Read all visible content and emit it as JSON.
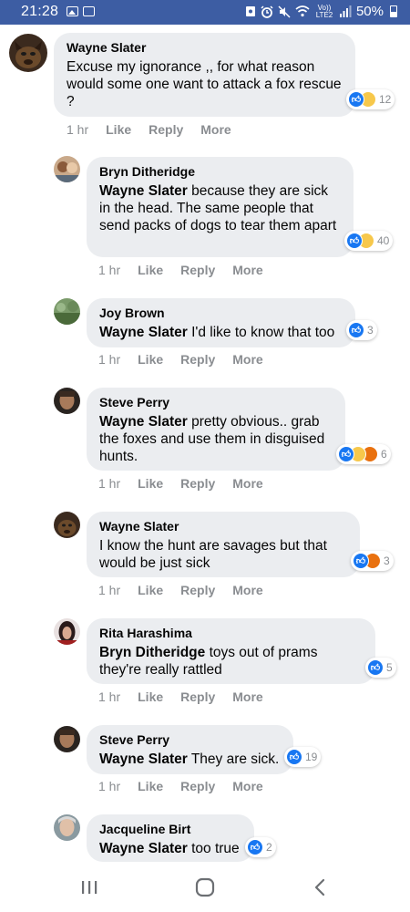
{
  "status_bar": {
    "time": "21:28",
    "network_label": "Vo)) LTE2",
    "battery": "50%"
  },
  "comments": [
    {
      "author": "Wayne Slater",
      "tag": "",
      "text": "Excuse my ignorance ,, for what reason would some one want to attack a fox rescue ?",
      "time": "1 hr",
      "like_label": "Like",
      "reply_label": "Reply",
      "more_label": "More",
      "reaction_count": "12",
      "reactions": [
        "like",
        "sad"
      ]
    },
    {
      "author": "Bryn Ditheridge",
      "tag": "Wayne Slater",
      "text": "because they are sick in the head. The same people that send packs of dogs to tear them apart",
      "time": "1 hr",
      "like_label": "Like",
      "reply_label": "Reply",
      "more_label": "More",
      "reaction_count": "40",
      "reactions": [
        "like",
        "sad"
      ]
    },
    {
      "author": "Joy Brown",
      "tag": "Wayne Slater",
      "text": "I'd like to know that too",
      "time": "1 hr",
      "like_label": "Like",
      "reply_label": "Reply",
      "more_label": "More",
      "reaction_count": "3",
      "reactions": [
        "like"
      ]
    },
    {
      "author": "Steve Perry",
      "tag": "Wayne Slater",
      "text": "pretty obvious.. grab the foxes and use them in disguised hunts.",
      "time": "1 hr",
      "like_label": "Like",
      "reply_label": "Reply",
      "more_label": "More",
      "reaction_count": "6",
      "reactions": [
        "like",
        "sad",
        "angry"
      ]
    },
    {
      "author": "Wayne Slater",
      "tag": "",
      "text": "I know the hunt are savages but that would be just sick",
      "time": "1 hr",
      "like_label": "Like",
      "reply_label": "Reply",
      "more_label": "More",
      "reaction_count": "3",
      "reactions": [
        "like",
        "angry"
      ]
    },
    {
      "author": "Rita Harashima",
      "tag": "Bryn Ditheridge",
      "text": "toys out of prams they're really rattled",
      "time": "1 hr",
      "like_label": "Like",
      "reply_label": "Reply",
      "more_label": "More",
      "reaction_count": "5",
      "reactions": [
        "like"
      ]
    },
    {
      "author": "Steve Perry",
      "tag": "Wayne Slater",
      "text": "They are sick.",
      "time": "1 hr",
      "like_label": "Like",
      "reply_label": "Reply",
      "more_label": "More",
      "reaction_count": "19",
      "reactions": [
        "like"
      ]
    },
    {
      "author": "Jacqueline Birt",
      "tag": "Wayne Slater",
      "text": "too true",
      "time": "",
      "like_label": "",
      "reply_label": "",
      "more_label": "",
      "reaction_count": "2",
      "reactions": [
        "like"
      ]
    }
  ],
  "colors": {
    "status_bar": "#3d5da3",
    "bubble": "#ebedf0",
    "like_blue": "#1877f2",
    "sad_yellow": "#f7c84b",
    "angry_orange": "#e9710f",
    "meta_grey": "#8a8d91"
  },
  "nav": {
    "recents_icon": "recent-apps-icon",
    "home_icon": "home-icon",
    "back_icon": "back-icon"
  }
}
